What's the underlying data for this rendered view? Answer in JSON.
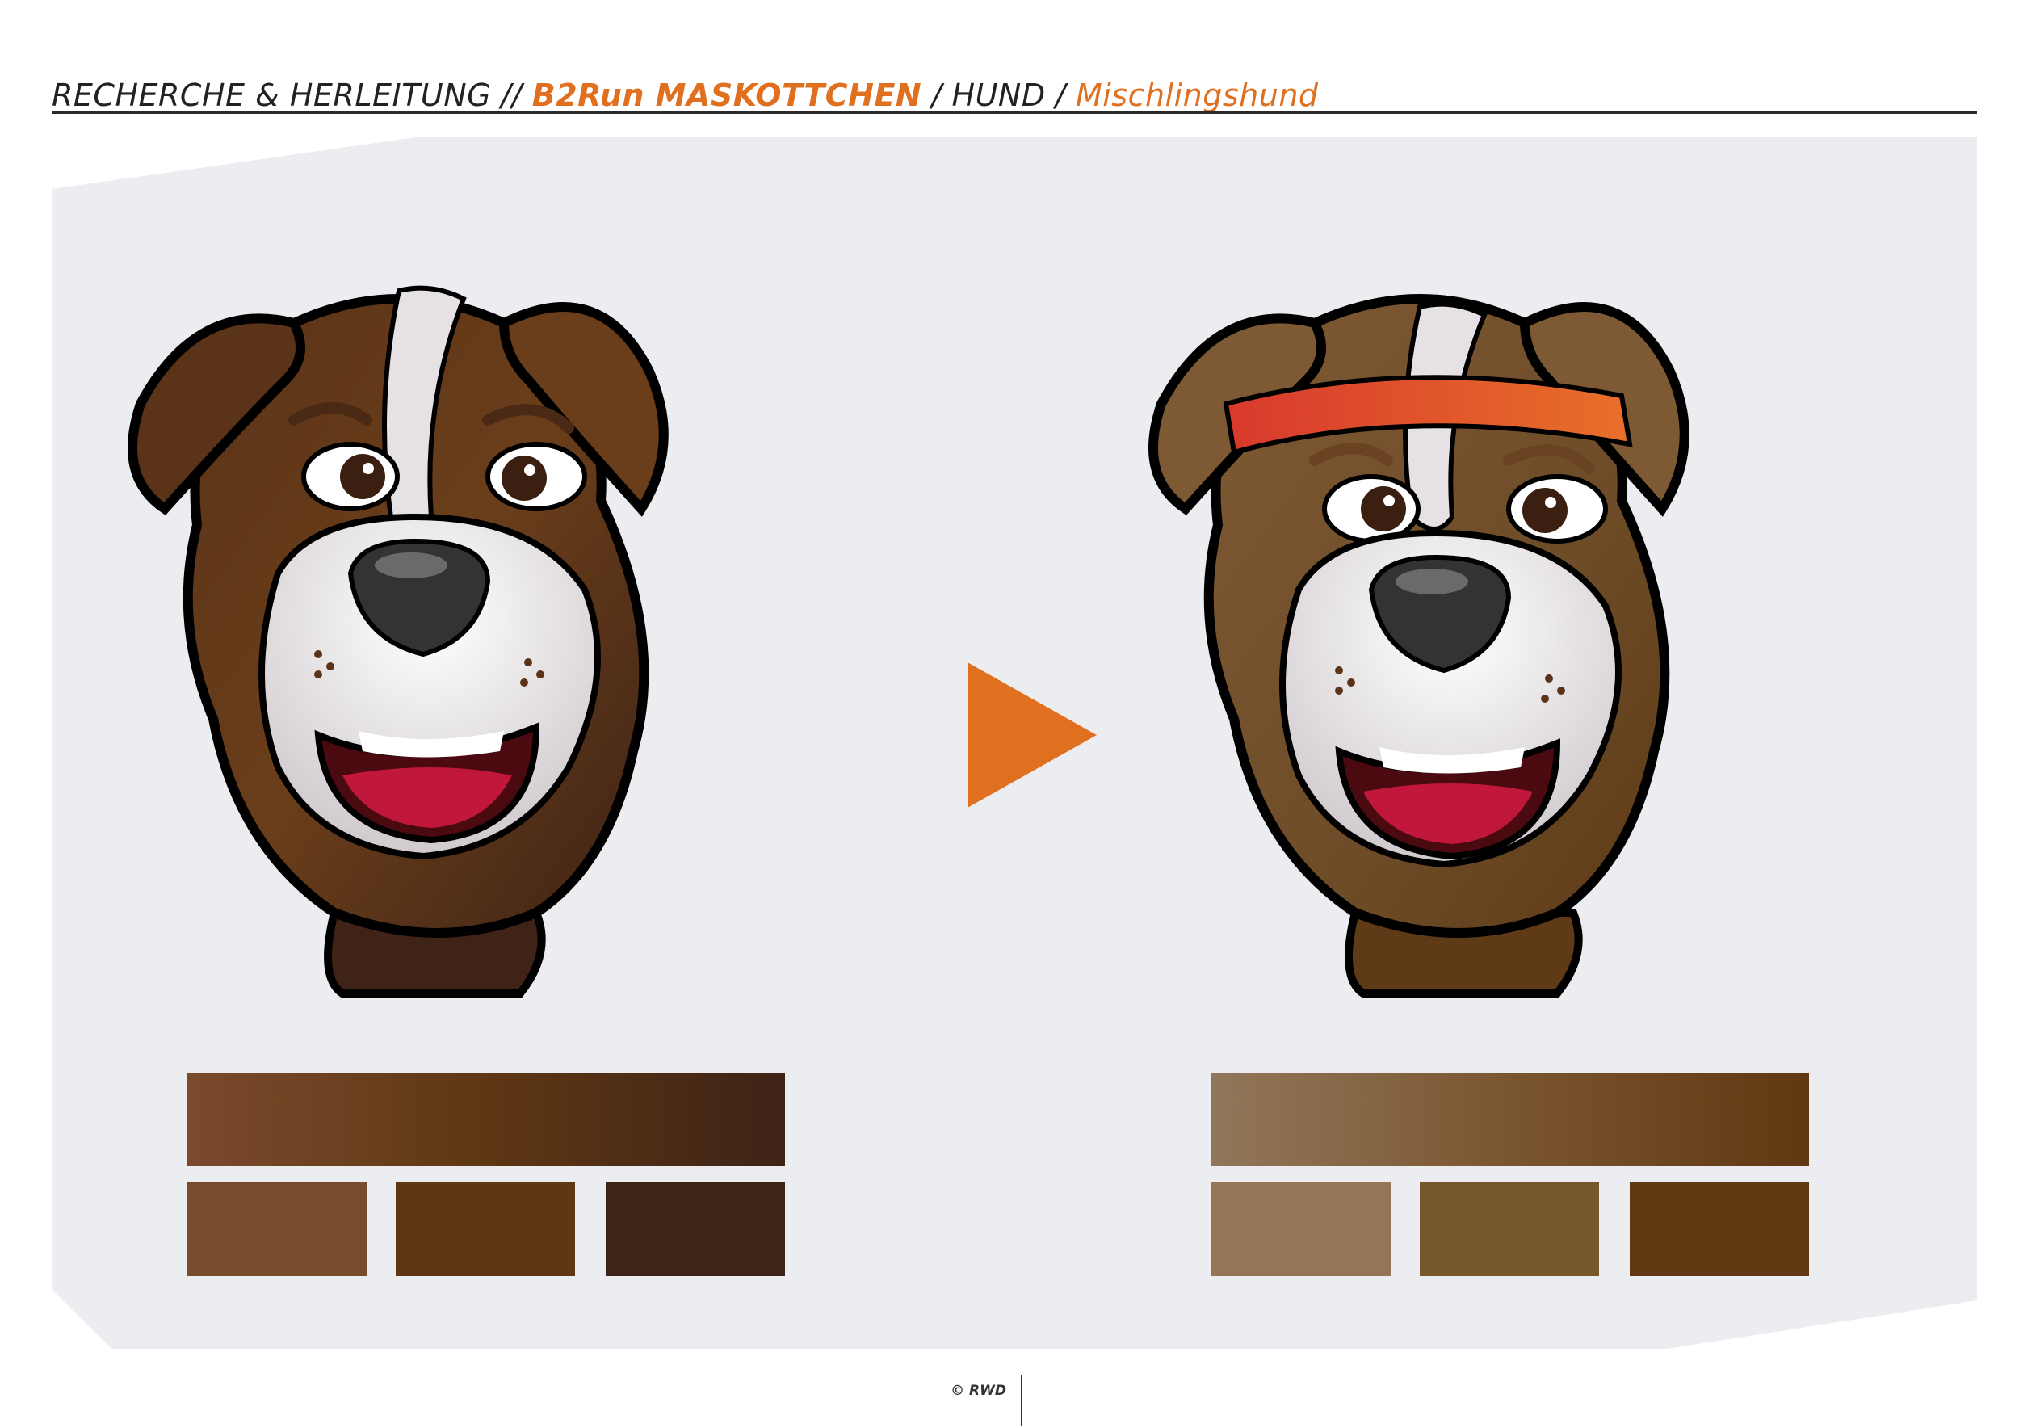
{
  "header": {
    "part1": "RECHERCHE & HERLEITUNG",
    "sep1": "//",
    "part2": "B2Run MASKOTTCHEN",
    "sep2": "/",
    "part3": "HUND",
    "sep3": "/",
    "part4": "Mischlingshund"
  },
  "colors": {
    "accent": "#e07020",
    "panel_bg": "#ecedf1",
    "left_palette": {
      "gradient": [
        "#7a4a2c",
        "#5e3714",
        "#3e2316"
      ],
      "swatches": [
        "#784b2c",
        "#5f3714",
        "#3e2317"
      ]
    },
    "right_palette": {
      "gradient": [
        "#92765a",
        "#7a5630",
        "#603812"
      ],
      "swatches": [
        "#947657",
        "#77572c",
        "#603812"
      ]
    }
  },
  "icons": {
    "arrow": "play-arrow-icon",
    "left_figure": "dog-mascot-original-icon",
    "right_figure": "dog-mascot-headband-icon"
  },
  "footer": {
    "copyright": "© RWD"
  }
}
